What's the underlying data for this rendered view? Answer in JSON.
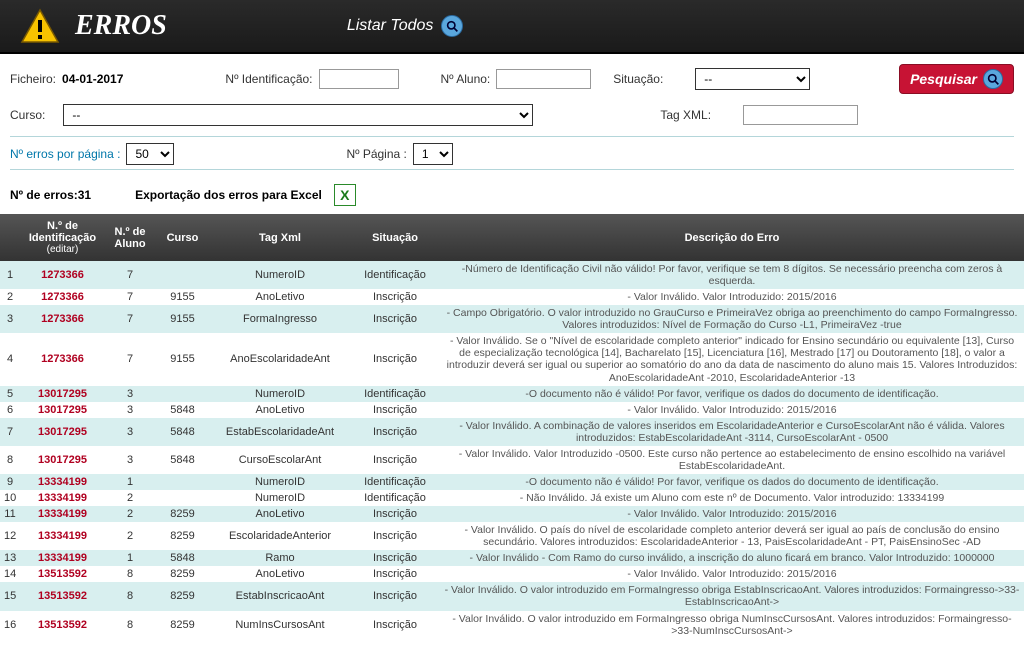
{
  "header": {
    "title": "ERROS",
    "listar": "Listar Todos"
  },
  "filters": {
    "ficheiro_lbl": "Ficheiro:",
    "ficheiro_val": "04-01-2017",
    "nident_lbl": "Nº Identificação:",
    "naluno_lbl": "Nº Aluno:",
    "situacao_lbl": "Situação:",
    "situacao_val": "--",
    "pesquisar": "Pesquisar",
    "curso_lbl": "Curso:",
    "curso_val": "--",
    "tagxml_lbl": "Tag XML:",
    "perpage_lbl": "Nº erros por página :",
    "perpage_val": "50",
    "npagina_lbl": "Nº Página :",
    "npagina_val": "1"
  },
  "summary": {
    "count_lbl": "Nº de erros:",
    "count_val": "31",
    "export_lbl": "Exportação dos erros para Excel"
  },
  "columns": {
    "id": "N.º de Identificação",
    "id_sub": "(editar)",
    "aluno": "N.º de Aluno",
    "curso": "Curso",
    "tag": "Tag Xml",
    "situacao": "Situação",
    "desc": "Descrição do Erro"
  },
  "rows": [
    {
      "n": "1",
      "id": "1273366",
      "aluno": "7",
      "curso": "",
      "tag": "NumeroID",
      "sit": "Identificação",
      "desc": "-Número de Identificação Civil não válido! Por favor, verifique se tem 8 dígitos. Se necessário preencha com zeros à esquerda."
    },
    {
      "n": "2",
      "id": "1273366",
      "aluno": "7",
      "curso": "9155",
      "tag": "AnoLetivo",
      "sit": "Inscrição",
      "desc": "- Valor Inválido. Valor Introduzido: 2015/2016"
    },
    {
      "n": "3",
      "id": "1273366",
      "aluno": "7",
      "curso": "9155",
      "tag": "FormaIngresso",
      "sit": "Inscrição",
      "desc": "- Campo Obrigatório. O valor introduzido no GrauCurso e PrimeiraVez obriga ao preenchimento do campo FormaIngresso. Valores introduzidos: Nível de Formação do Curso -L1, PrimeiraVez -true"
    },
    {
      "n": "4",
      "id": "1273366",
      "aluno": "7",
      "curso": "9155",
      "tag": "AnoEscolaridadeAnt",
      "sit": "Inscrição",
      "desc": "- Valor Inválido. Se o \"Nível de escolaridade completo anterior\" indicado for Ensino secundário ou equivalente [13], Curso de especialização tecnológica [14], Bacharelato [15], Licenciatura [16], Mestrado [17] ou Doutoramento [18], o valor a introduzir deverá ser igual ou superior ao somatório do ano da data de nascimento do aluno mais 15. Valores Introduzidos: AnoEscolaridadeAnt -2010, EscolaridadeAnterior -13"
    },
    {
      "n": "5",
      "id": "13017295",
      "aluno": "3",
      "curso": "",
      "tag": "NumeroID",
      "sit": "Identificação",
      "desc": "-O documento não é válido! Por favor, verifique os dados do documento de identificação."
    },
    {
      "n": "6",
      "id": "13017295",
      "aluno": "3",
      "curso": "5848",
      "tag": "AnoLetivo",
      "sit": "Inscrição",
      "desc": "- Valor Inválido. Valor Introduzido: 2015/2016"
    },
    {
      "n": "7",
      "id": "13017295",
      "aluno": "3",
      "curso": "5848",
      "tag": "EstabEscolaridadeAnt",
      "sit": "Inscrição",
      "desc": "- Valor Inválido. A combinação de valores inseridos em EscolaridadeAnterior e CursoEscolarAnt não é válida. Valores introduzidos: EstabEscolaridadeAnt -3114, CursoEscolarAnt - 0500"
    },
    {
      "n": "8",
      "id": "13017295",
      "aluno": "3",
      "curso": "5848",
      "tag": "CursoEscolarAnt",
      "sit": "Inscrição",
      "desc": "- Valor Inválido. Valor Introduzido -0500. Este curso não pertence ao estabelecimento de ensino escolhido na variável EstabEscolaridadeAnt."
    },
    {
      "n": "9",
      "id": "13334199",
      "aluno": "1",
      "curso": "",
      "tag": "NumeroID",
      "sit": "Identificação",
      "desc": "-O documento não é válido! Por favor, verifique os dados do documento de identificação."
    },
    {
      "n": "10",
      "id": "13334199",
      "aluno": "2",
      "curso": "",
      "tag": "NumeroID",
      "sit": "Identificação",
      "desc": "- Não Inválido. Já existe um Aluno com este nº de Documento. Valor introduzido: 13334199"
    },
    {
      "n": "11",
      "id": "13334199",
      "aluno": "2",
      "curso": "8259",
      "tag": "AnoLetivo",
      "sit": "Inscrição",
      "desc": "- Valor Inválido. Valor Introduzido: 2015/2016"
    },
    {
      "n": "12",
      "id": "13334199",
      "aluno": "2",
      "curso": "8259",
      "tag": "EscolaridadeAnterior",
      "sit": "Inscrição",
      "desc": "- Valor Inválido. O país do nível de escolaridade completo anterior deverá ser igual ao país de conclusão do ensino secundário. Valores introduzidos: EscolaridadeAnterior - 13, PaisEscolaridadeAnt - PT, PaisEnsinoSec -AD"
    },
    {
      "n": "13",
      "id": "13334199",
      "aluno": "1",
      "curso": "5848",
      "tag": "Ramo",
      "sit": "Inscrição",
      "desc": "- Valor Inválido - Com Ramo do curso inválido, a inscrição do aluno ficará em branco. Valor Introduzido: 1000000"
    },
    {
      "n": "14",
      "id": "13513592",
      "aluno": "8",
      "curso": "8259",
      "tag": "AnoLetivo",
      "sit": "Inscrição",
      "desc": "- Valor Inválido. Valor Introduzido: 2015/2016"
    },
    {
      "n": "15",
      "id": "13513592",
      "aluno": "8",
      "curso": "8259",
      "tag": "EstabInscricaoAnt",
      "sit": "Inscrição",
      "desc": "- Valor Inválido. O valor introduzido em FormaIngresso obriga EstabInscricaoAnt. Valores introduzidos: Formaingresso->33-EstabInscricaoAnt->"
    },
    {
      "n": "16",
      "id": "13513592",
      "aluno": "8",
      "curso": "8259",
      "tag": "NumInsCursosAnt",
      "sit": "Inscrição",
      "desc": "- Valor Inválido. O valor introduzido em FormaIngresso obriga NumInscCursosAnt. Valores introduzidos: Formaingresso->33-NumInscCursosAnt->"
    }
  ]
}
